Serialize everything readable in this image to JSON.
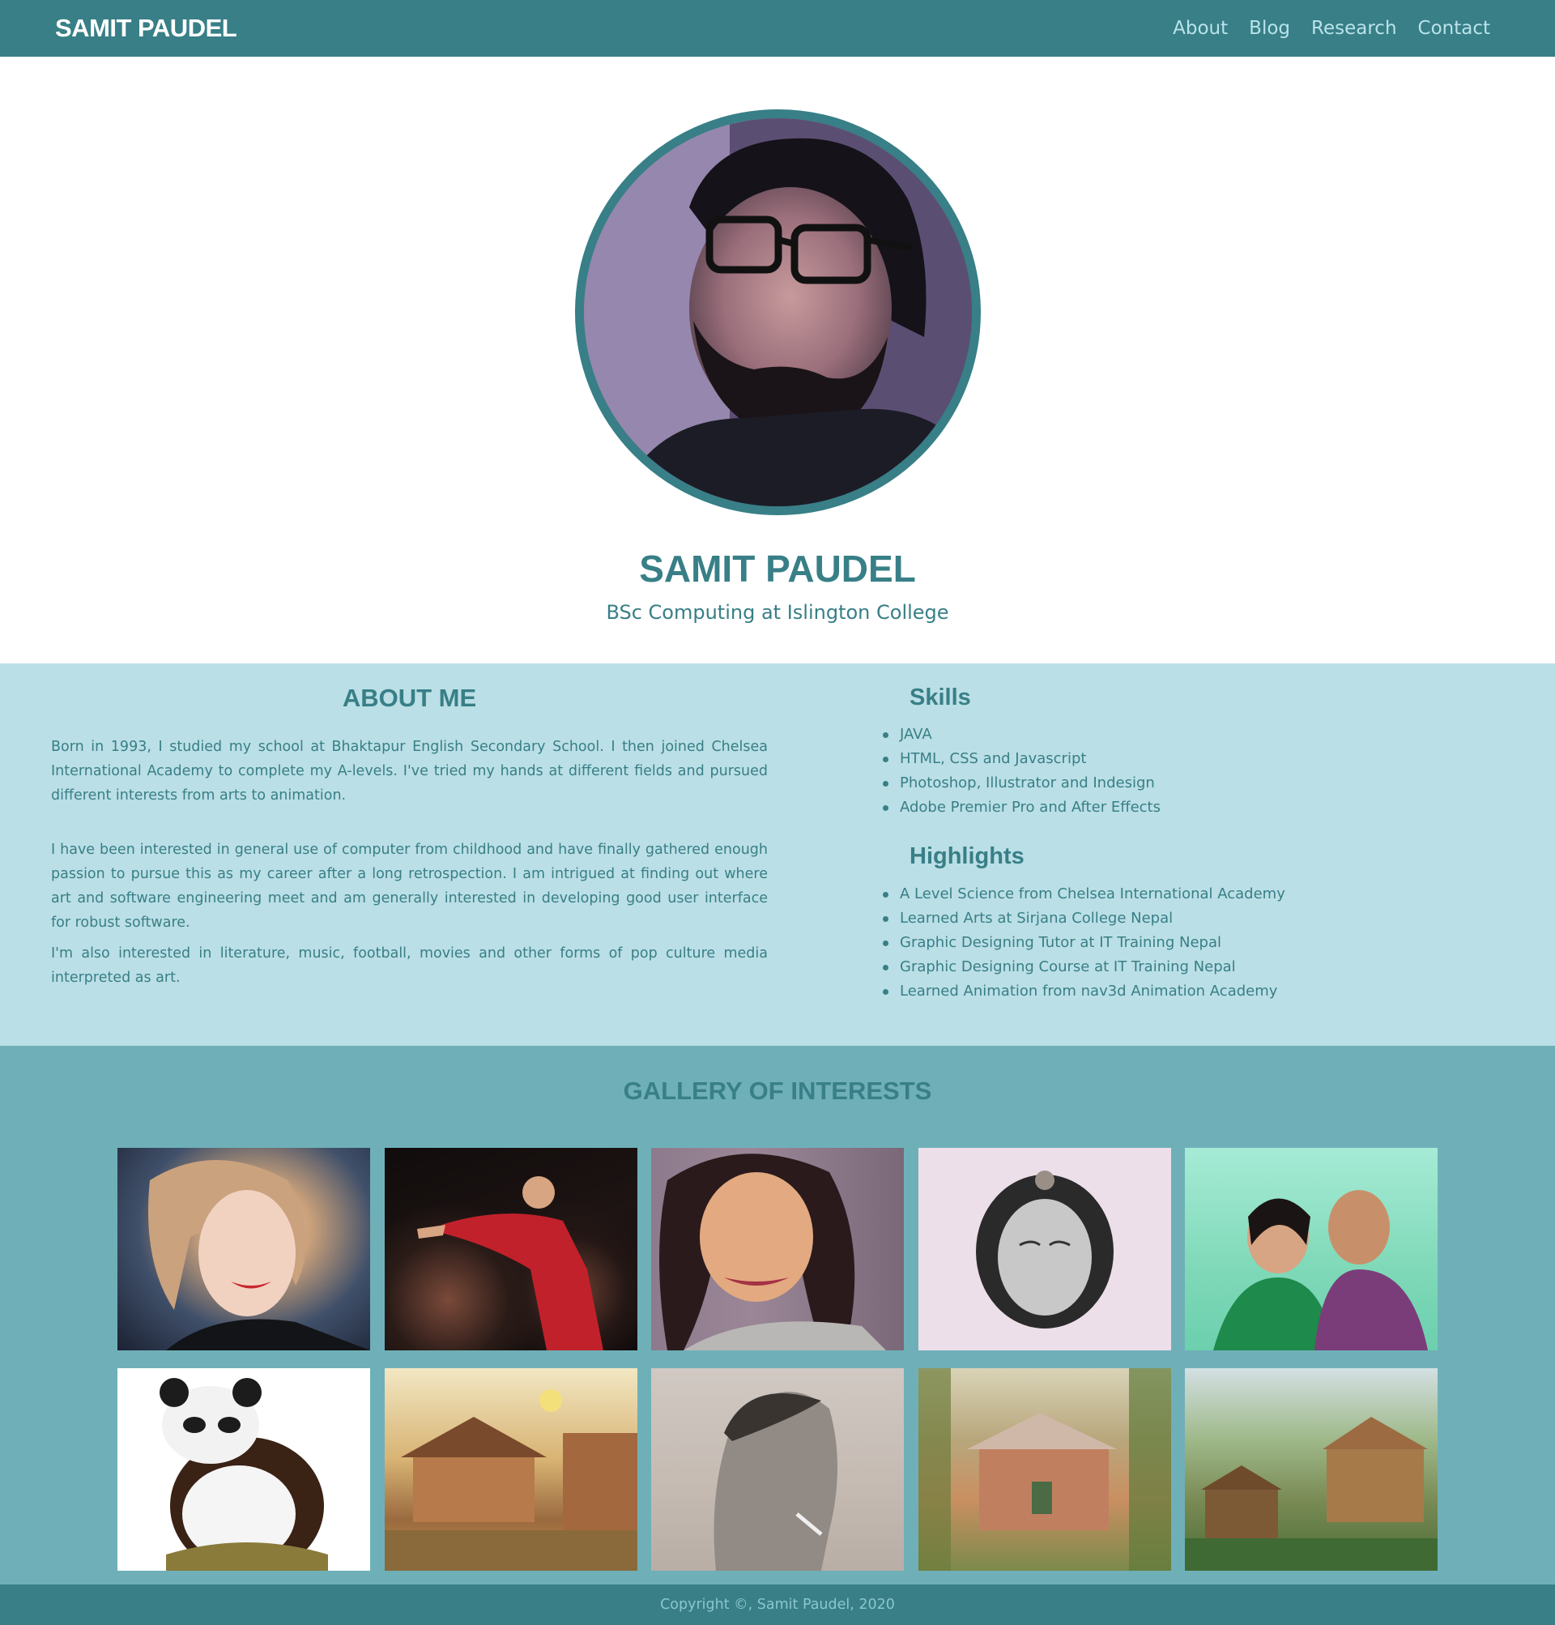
{
  "navbar": {
    "brand": "SAMIT PAUDEL",
    "links": [
      {
        "label": "About"
      },
      {
        "label": "Blog"
      },
      {
        "label": "Research"
      },
      {
        "label": "Contact"
      }
    ]
  },
  "hero": {
    "name": "SAMIT PAUDEL",
    "subtitle": "BSc Computing at Islington College"
  },
  "about": {
    "title": "ABOUT ME",
    "paragraphs": [
      "Born in 1993, I studied my school at Bhaktapur English Secondary School. I then joined Chelsea International Academy to complete my A-levels. I've tried my hands at different fields and pursued different interests from arts to animation.",
      "I have been interested in general use of computer from childhood and have finally gathered enough passion to pursue this as my career after a long retrospection. I am intrigued at finding out where art and software engineering meet and am generally interested in developing good user interface for robust software.",
      "I'm also interested in literature, music, football, movies and other forms of pop culture media interpreted as art."
    ]
  },
  "skills": {
    "title": "Skills",
    "items": [
      "JAVA",
      "HTML, CSS and Javascript",
      "Photoshop, Illustrator and Indesign",
      "Adobe Premier Pro and After Effects"
    ]
  },
  "highlights": {
    "title": "Highlights",
    "items": [
      "A Level Science from Chelsea International Academy",
      "Learned Arts at Sirjana College Nepal",
      "Graphic Designing Tutor at IT Training Nepal",
      "Graphic Designing Course at IT Training Nepal",
      "Learned Animation from nav3d Animation Academy"
    ]
  },
  "gallery": {
    "title": "GALLERY OF INTERESTS"
  },
  "footer": {
    "copyright": "Copyright ©, Samit Paudel, 2020"
  },
  "colors": {
    "primary": "#387f87",
    "about_bg": "#bbdfe6",
    "gallery_bg": "#6fb0b8",
    "nav_link": "#b9e3ea"
  }
}
